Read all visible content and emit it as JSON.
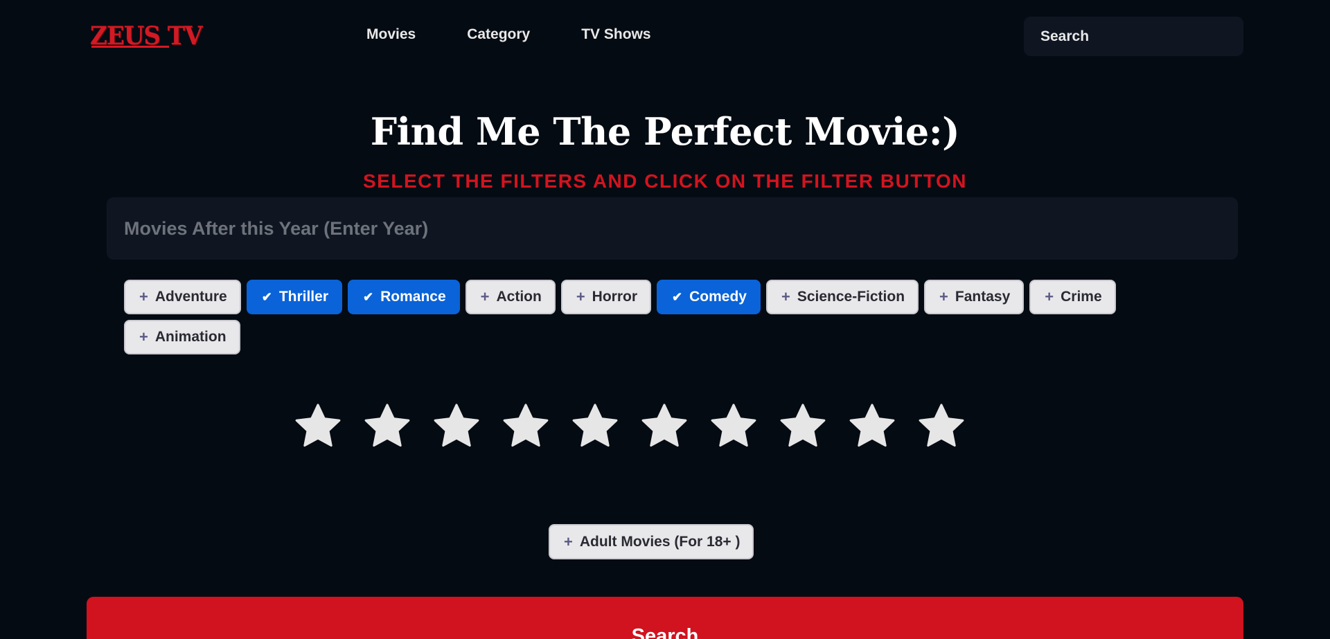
{
  "header": {
    "logo": "ZEUS TV",
    "nav": [
      "Movies",
      "Category",
      "TV Shows"
    ],
    "search_placeholder": "Search"
  },
  "main": {
    "title": "Find Me The Perfect Movie:)",
    "subtitle": "SELECT THE FILTERS AND CLICK ON THE FILTER BUTTON",
    "year_placeholder": "Movies After this Year (Enter Year)",
    "genres": [
      {
        "label": "Adventure",
        "selected": false
      },
      {
        "label": "Thriller",
        "selected": true
      },
      {
        "label": "Romance",
        "selected": true
      },
      {
        "label": "Action",
        "selected": false
      },
      {
        "label": "Horror",
        "selected": false
      },
      {
        "label": "Comedy",
        "selected": true
      },
      {
        "label": "Science-Fiction",
        "selected": false
      },
      {
        "label": "Fantasy",
        "selected": false
      },
      {
        "label": "Crime",
        "selected": false
      },
      {
        "label": "Animation",
        "selected": false
      }
    ],
    "rating": {
      "max": 10,
      "value": 0
    },
    "adult_label": "Adult Movies (For 18+ )",
    "search_button": "Search"
  },
  "colors": {
    "background": "#050b13",
    "accent_red": "#d0131f",
    "selected_blue": "#0a63d8",
    "chip_bg": "#e8e8eb",
    "star": "#e6e6e6"
  },
  "icons": {
    "search": "search-icon",
    "add": "plus-icon",
    "selected": "check-icon",
    "rating": "star-icon"
  }
}
